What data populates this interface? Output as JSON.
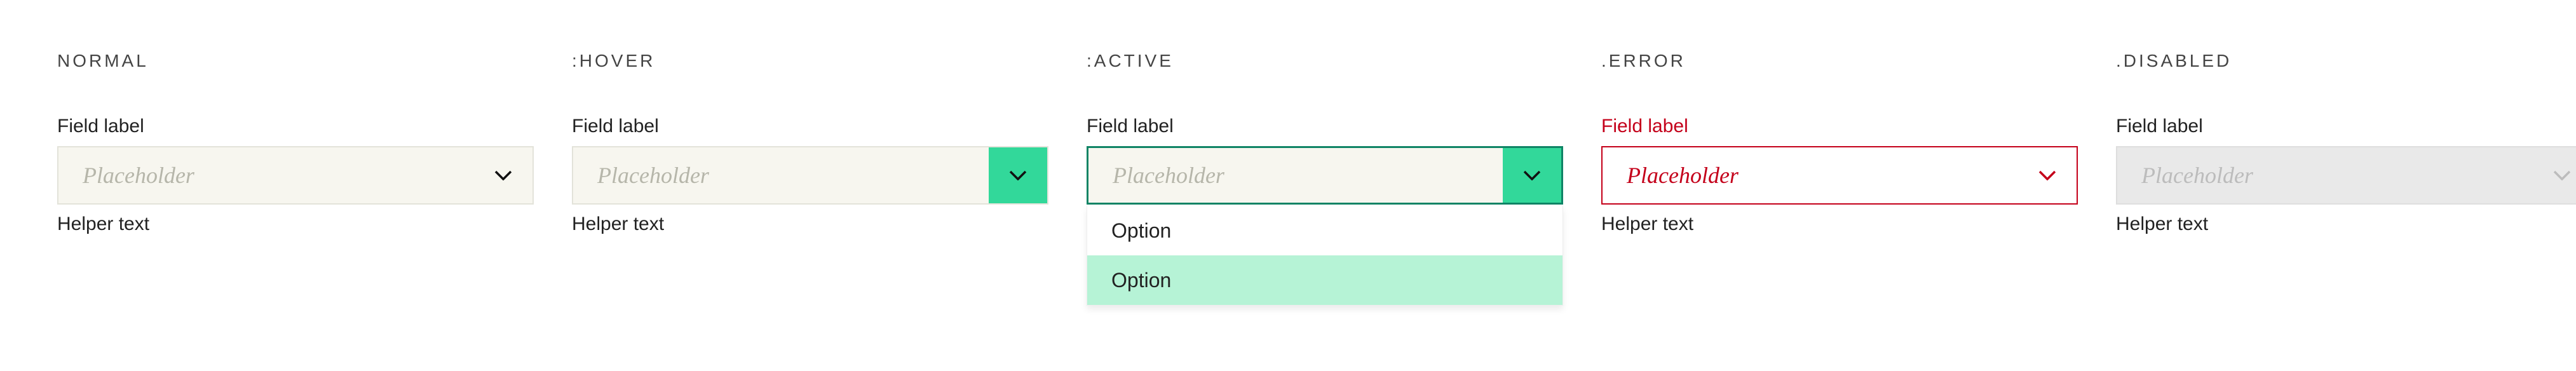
{
  "states": {
    "normal": {
      "heading": "NORMAL",
      "label": "Field label",
      "placeholder": "Placeholder",
      "helper": "Helper text"
    },
    "hover": {
      "heading": ":HOVER",
      "label": "Field label",
      "placeholder": "Placeholder",
      "helper": "Helper text"
    },
    "active": {
      "heading": ":ACTIVE",
      "label": "Field label",
      "placeholder": "Placeholder",
      "options": [
        "Option",
        "Option"
      ]
    },
    "error": {
      "heading": ".ERROR",
      "label": "Field label",
      "placeholder": "Placeholder",
      "helper": "Helper text"
    },
    "disabled": {
      "heading": ".DISABLED",
      "label": "Field label",
      "placeholder": "Placeholder",
      "helper": "Helper text"
    }
  },
  "colors": {
    "accent": "#32d89a",
    "accent_border": "#0f8465",
    "error": "#c4001a",
    "bg_field": "#f7f6ef",
    "bg_disabled": "#e9e9e9"
  }
}
